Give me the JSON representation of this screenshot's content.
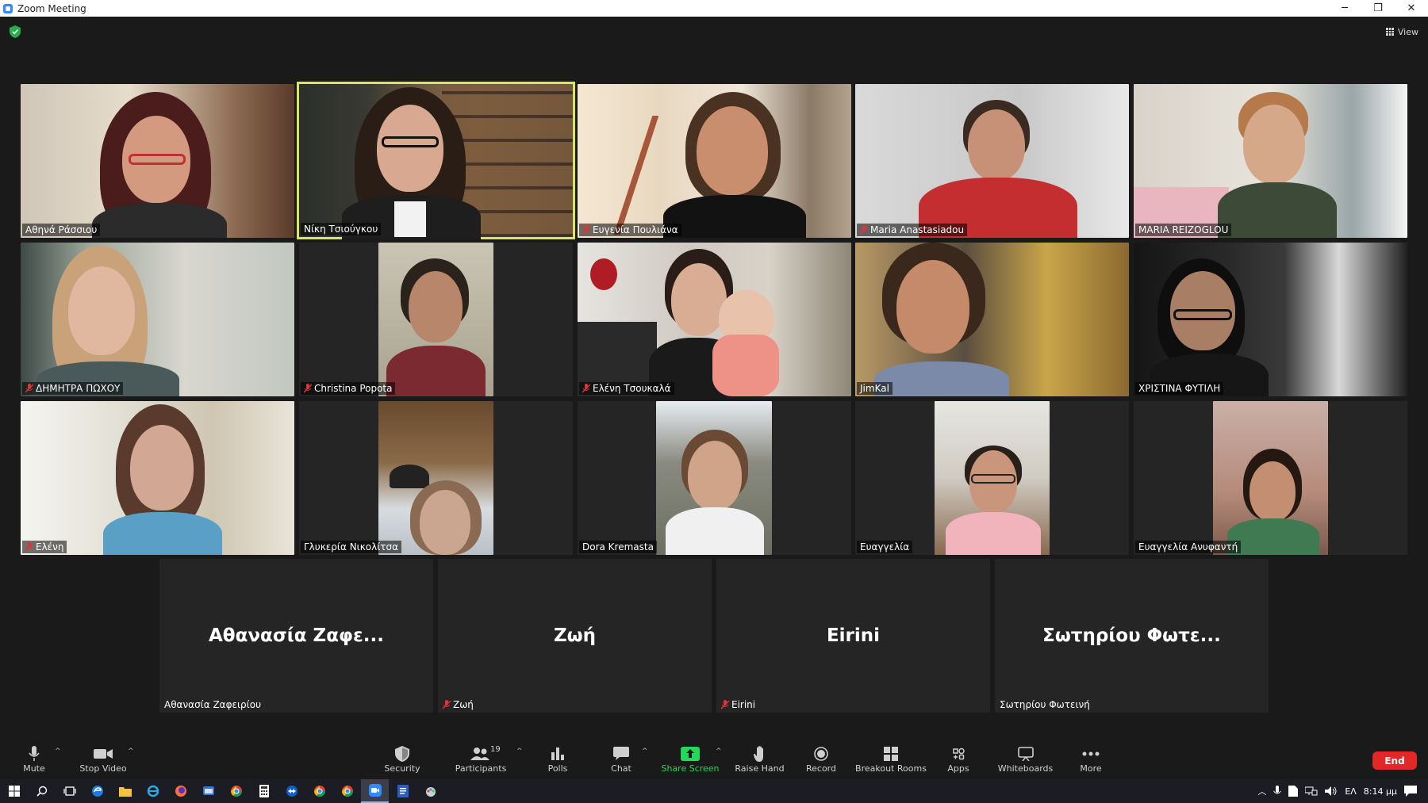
{
  "window": {
    "title": "Zoom Meeting",
    "controls": [
      "─",
      "❐",
      "✕"
    ]
  },
  "top_bar": {
    "view_label": "View"
  },
  "participants_video": [
    {
      "name": "Αθηνά Ράσσιου",
      "muted": false
    },
    {
      "name": "Νίκη Τσιούγκου",
      "muted": false,
      "active_speaker": true
    },
    {
      "name": "Ευγενία Πουλιάνα",
      "muted": true
    },
    {
      "name": "Maria Anastasiadou",
      "muted": true
    },
    {
      "name": "MARIA REIZOGLOU",
      "muted": false
    },
    {
      "name": "ΔΗΜΗΤΡΑ ΠΩΧΟΥ",
      "muted": true
    },
    {
      "name": "Christina Popota",
      "muted": true
    },
    {
      "name": "Ελένη Τσουκαλά",
      "muted": true
    },
    {
      "name": "JimKal",
      "muted": false
    },
    {
      "name": "ΧΡΙΣΤΙΝΑ ΦΥΤΙΛΗ",
      "muted": false
    },
    {
      "name": "Ελένη",
      "muted": true
    },
    {
      "name": "Γλυκερία Νικολίτσα",
      "muted": false
    },
    {
      "name": "Dora Kremasta",
      "muted": false
    },
    {
      "name": "Ευαγγελία",
      "muted": false
    },
    {
      "name": "Ευαγγελία Ανυφαντή",
      "muted": false
    }
  ],
  "participants_audio": [
    {
      "display": "Αθανασία Ζαφε...",
      "name": "Αθανασία Ζαφειρίου",
      "muted": false
    },
    {
      "display": "Ζωή",
      "name": "Ζωή",
      "muted": true
    },
    {
      "display": "Eirini",
      "name": "Eirini",
      "muted": true
    },
    {
      "display": "Σωτηρίου Φωτε...",
      "name": "Σωτηρίου Φωτεινή",
      "muted": false
    }
  ],
  "toolbar": {
    "mute": "Mute",
    "stop_video": "Stop Video",
    "security": "Security",
    "participants": "Participants",
    "participants_count": "19",
    "polls": "Polls",
    "chat": "Chat",
    "share_screen": "Share Screen",
    "raise_hand": "Raise Hand",
    "record": "Record",
    "breakout_rooms": "Breakout Rooms",
    "apps": "Apps",
    "whiteboards": "Whiteboards",
    "more": "More",
    "end": "End"
  },
  "taskbar": {
    "language": "ΕΛ",
    "time": "8:14 μμ"
  },
  "colors": {
    "accent_green": "#23d959",
    "end_red": "#e02828",
    "active_border": "#d9e85b",
    "background": "#1a1a1a",
    "tile": "#252525"
  }
}
